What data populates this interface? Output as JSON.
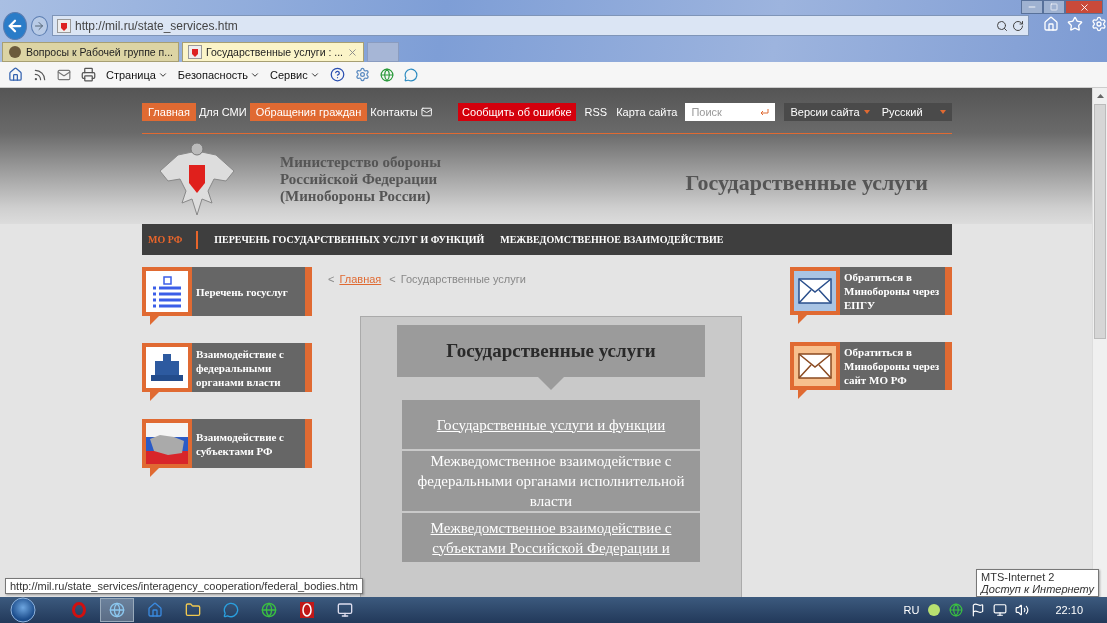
{
  "browser": {
    "address": "http://mil.ru/state_services.htm",
    "tabs": [
      {
        "label": "Вопросы к Рабочей группе п...",
        "selected": false
      },
      {
        "label": "Государственные услуги : ...",
        "selected": true
      }
    ],
    "menus": [
      "Страница",
      "Безопасность",
      "Сервис"
    ]
  },
  "page": {
    "top_links": [
      {
        "label": "Главная",
        "kind": "highlight"
      },
      {
        "label": "Для СМИ",
        "kind": "plain"
      },
      {
        "label": "Обращения граждан",
        "kind": "highlight"
      },
      {
        "label": "Контакты",
        "kind": "plain"
      }
    ],
    "report_button": "Сообщить об ошибке",
    "rss": "RSS",
    "sitemap": "Карта сайта",
    "search": {
      "placeholder": "Поиск"
    },
    "versions": "Версии сайта",
    "language": "Русский",
    "ministry": [
      "Министерство обороны",
      "Российской Федерации",
      "(Минобороны России)"
    ],
    "title": "Государственные услуги",
    "nav": [
      {
        "label": "МО РФ",
        "selected": true
      },
      {
        "label": "ПЕРЕЧЕНЬ ГОСУДАРСТВЕННЫХ УСЛУГ И ФУНКЦИЙ",
        "selected": false
      },
      {
        "label": "МЕЖВЕДОМСТВЕННОЕ ВЗАИМОДЕЙСТВИЕ",
        "selected": false
      }
    ],
    "left_cards": [
      {
        "label": "Перечень госуслуг",
        "kind": "list"
      },
      {
        "label": "Взаимодействие с федеральными органами власти",
        "kind": "building"
      },
      {
        "label": "Взаимодействие с субъектами РФ",
        "kind": "map"
      }
    ],
    "breadcrumb": {
      "separator": "<",
      "home": "Главная",
      "current": "Государственные услуги"
    },
    "panel": {
      "title": "Государственные услуги",
      "items": [
        {
          "label": "Государственные услуги и функции",
          "kind": "link"
        },
        {
          "label": "Межведомственное взаимодействие с федеральными органами исполнительной власти",
          "kind": "text"
        },
        {
          "label": "Межведомственное взаимодействие с субъектами Российской Федерации и",
          "kind": "link"
        }
      ]
    },
    "right_cards": [
      {
        "label": "Обратиться в Минобороны через ЕПГУ",
        "kind": "blue"
      },
      {
        "label": "Обратиться в Минобороны через сайт МО РФ",
        "kind": "orange"
      }
    ]
  },
  "status_url": "http://mil.ru/state_services/interagency_cooperation/federal_bodies.htm",
  "network_tooltip": {
    "name": "MTS-Internet  2",
    "status": "Доступ к Интернету"
  },
  "taskbar": {
    "language": "RU",
    "clock": "22:10"
  }
}
